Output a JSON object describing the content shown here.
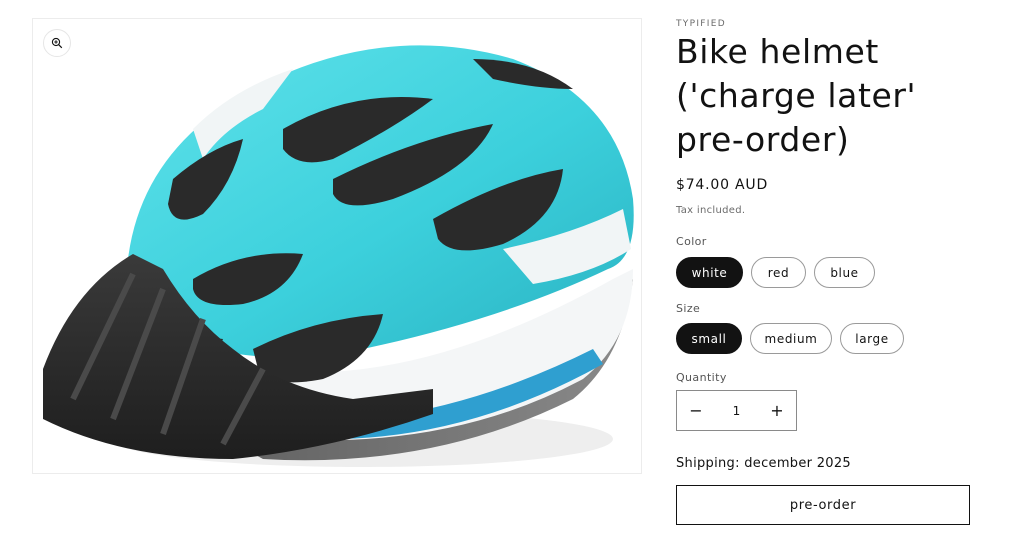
{
  "product": {
    "vendor": "TYPIFIED",
    "title": "Bike helmet ('charge later' pre-order)",
    "price": "$74.00 AUD",
    "tax_note": "Tax included."
  },
  "media": {
    "zoom_icon": "zoom-in-icon",
    "image_subject": "cyan bike helmet"
  },
  "options": {
    "color": {
      "label": "Color",
      "values": [
        "white",
        "red",
        "blue"
      ],
      "selected": "white"
    },
    "size": {
      "label": "Size",
      "values": [
        "small",
        "medium",
        "large"
      ],
      "selected": "small"
    }
  },
  "quantity": {
    "label": "Quantity",
    "value": "1",
    "decrease_symbol": "−",
    "increase_symbol": "+"
  },
  "shipping": {
    "text": "Shipping: december 2025"
  },
  "actions": {
    "preorder_label": "pre-order"
  },
  "colors": {
    "text": "#121212",
    "muted": "#6b6b6b",
    "selected_pill_bg": "#121212",
    "helmet_cyan": "#3cd0dc"
  }
}
